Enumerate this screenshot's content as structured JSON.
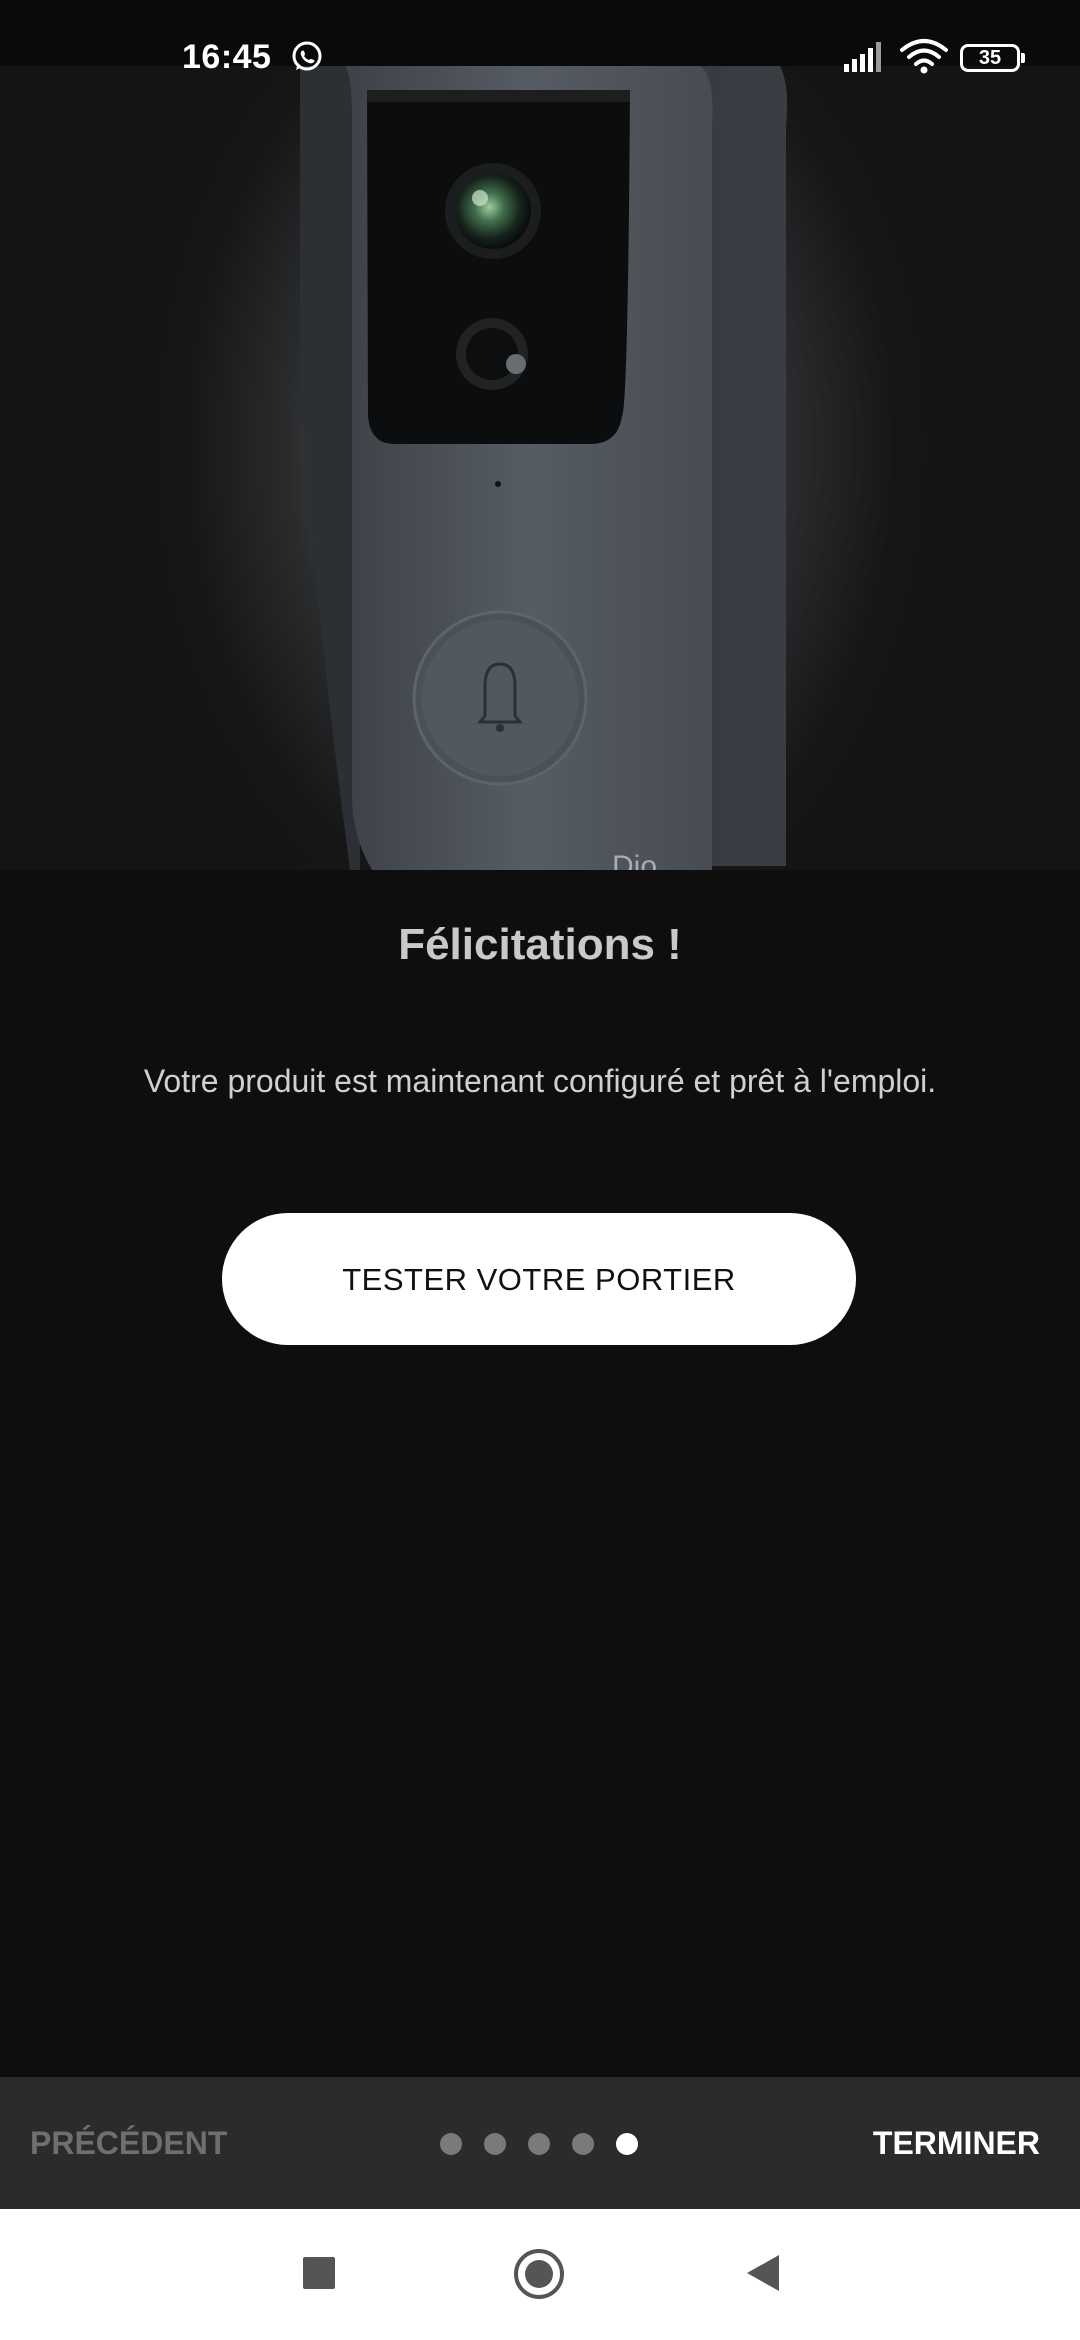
{
  "status_bar": {
    "time": "16:45",
    "battery": "35",
    "notification_icon": "whatsapp-icon",
    "signal_icon": "cell-signal-icon",
    "wifi_icon": "wifi-icon"
  },
  "hero": {
    "image": "video-doorbell-product-photo",
    "brand_text": "Dio"
  },
  "content": {
    "title": "Félicitations !",
    "subtitle": "Votre produit est maintenant configuré et prêt à l'emploi.",
    "test_button_label": "TESTER VOTRE PORTIER"
  },
  "wizard": {
    "previous_label": "PRÉCÉDENT",
    "finish_label": "TERMINER",
    "step_total": 5,
    "step_current": 5
  },
  "navigation": {
    "recent_icon": "square-recent-apps-icon",
    "home_icon": "circle-home-icon",
    "back_icon": "triangle-back-icon"
  },
  "colors": {
    "background": "#0e0e0e",
    "bar_background": "#2b2b2b",
    "button_background": "#ffffff",
    "disabled_text": "#6f6f6f"
  }
}
